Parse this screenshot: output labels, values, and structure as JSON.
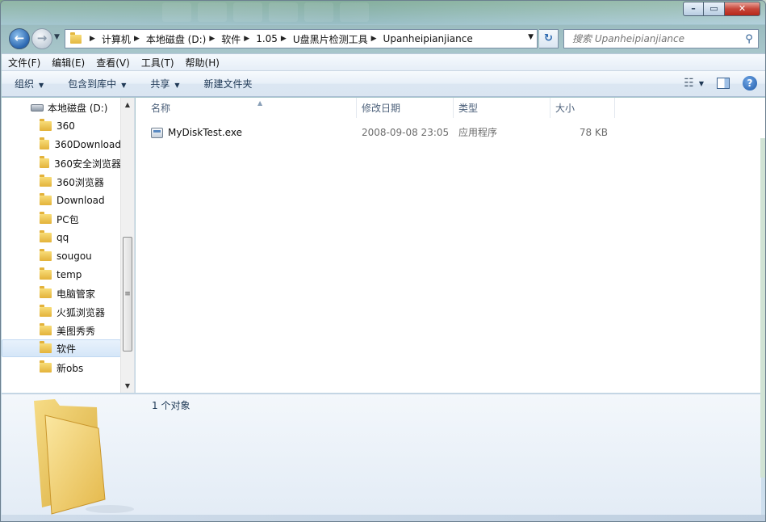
{
  "titlebar": {
    "blurred_tabs": [
      "",
      "",
      "",
      "",
      "",
      ""
    ],
    "controls": {
      "minimize": "–",
      "maximize": "▭",
      "close": "✕"
    }
  },
  "nav": {
    "back_glyph": "←",
    "forward_glyph": "→",
    "breadcrumb": [
      "计算机",
      "本地磁盘 (D:)",
      "软件",
      "1.05",
      "U盘黑片检测工具",
      "Upanheipianjiance"
    ],
    "refresh_glyph": "↻",
    "search_placeholder": "搜索 Upanheipianjiance"
  },
  "menubar": [
    "文件(F)",
    "编辑(E)",
    "查看(V)",
    "工具(T)",
    "帮助(H)"
  ],
  "commandbar": {
    "organize": "组织",
    "include_library": "包含到库中",
    "share": "共享",
    "new_folder": "新建文件夹",
    "help": "?"
  },
  "tree": {
    "drive": "本地磁盘 (D:)",
    "folders": [
      "360",
      "360Download",
      "360安全浏览器",
      "360浏览器",
      "Download",
      "PC包",
      "qq",
      "sougou",
      "temp",
      "电脑管家",
      "火狐浏览器",
      "美图秀秀",
      "软件",
      "新obs"
    ],
    "selected": "软件"
  },
  "columns": {
    "name": "名称",
    "modified": "修改日期",
    "type": "类型",
    "size": "大小"
  },
  "files": [
    {
      "name": "MyDiskTest.exe",
      "modified": "2008-09-08 23:05",
      "type": "应用程序",
      "size": "78 KB"
    }
  ],
  "details": {
    "count_text": "1 个对象"
  },
  "colors": {
    "accent": "#1e3855",
    "folder": "#e3b23a",
    "selection": "#d5e6f8"
  }
}
